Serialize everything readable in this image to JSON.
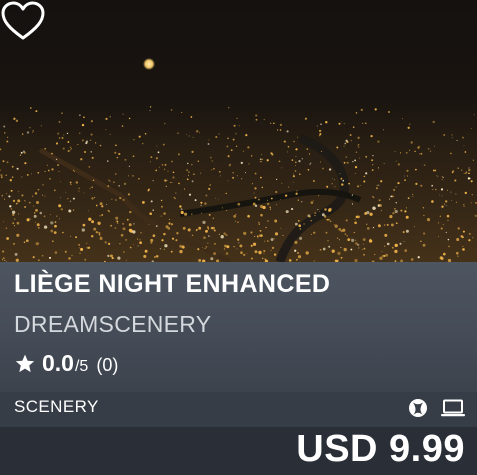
{
  "product": {
    "title": "LIÈGE NIGHT ENHANCED",
    "publisher": "DREAMSCENERY",
    "rating": {
      "score": "0.0",
      "out_of": "/5",
      "count": "(0)"
    },
    "category": "SCENERY",
    "platforms": [
      "xbox-icon",
      "pc-laptop-icon"
    ],
    "price": "USD 9.99"
  },
  "colors": {
    "panel": "#4d5560",
    "strip": "#373d46",
    "price_bar": "#2a2f37",
    "city_lights": "#f2b54b"
  }
}
